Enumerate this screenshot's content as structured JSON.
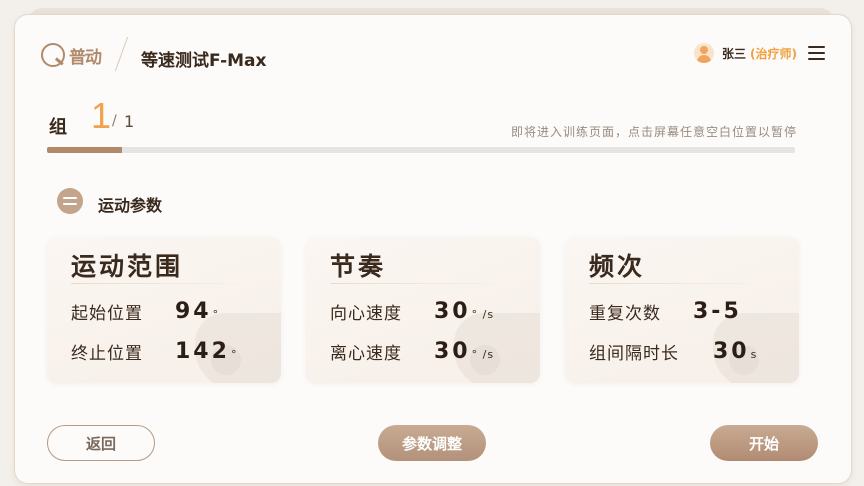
{
  "header": {
    "logo_text": "普动",
    "title": "等速测试F-Max",
    "user_name": "张三",
    "user_role": "(治疗师)",
    "avatar_icon": "person-avatar-icon",
    "menu_icon": "hamburger-menu-icon"
  },
  "group": {
    "label": "组",
    "current": "1",
    "separator": "/",
    "total": "1",
    "progress": 0.1
  },
  "hint": "即将进入训练页面，点击屏幕任意空白位置以暂停",
  "section": {
    "title": "运动参数",
    "icon": "sliders-icon"
  },
  "cards": [
    {
      "title": "运动范围",
      "rows": [
        {
          "label": "起始位置",
          "value": "94",
          "unit": "°"
        },
        {
          "label": "终止位置",
          "value": "142",
          "unit": "°"
        }
      ]
    },
    {
      "title": "节奏",
      "rows": [
        {
          "label": "向心速度",
          "value": "30",
          "unit": "° /s"
        },
        {
          "label": "离心速度",
          "value": "30",
          "unit": "° /s"
        }
      ]
    },
    {
      "title": "频次",
      "rows": [
        {
          "label": "重复次数",
          "value": "3-5",
          "unit": ""
        },
        {
          "label": "组间隔时长",
          "value": "30",
          "unit": "s"
        }
      ]
    }
  ],
  "buttons": {
    "back": "返回",
    "adjust": "参数调整",
    "start": "开始"
  },
  "colors": {
    "accent": "#b08a6b",
    "highlight": "#f2a24a",
    "role": "#f0a040"
  }
}
